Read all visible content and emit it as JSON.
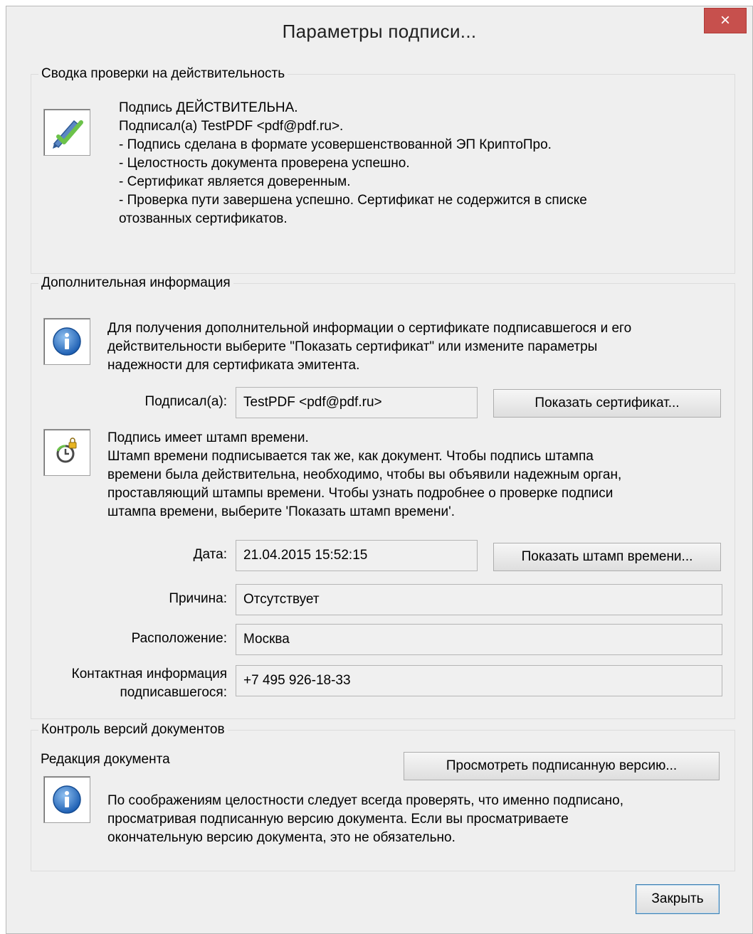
{
  "window": {
    "title": "Параметры подписи...",
    "close_glyph": "×"
  },
  "summary": {
    "legend": "Сводка проверки на действительность",
    "icon": "pen-checkmark-icon",
    "lines": [
      "Подпись ДЕЙСТВИТЕЛЬНА.",
      "Подписал(а) TestPDF <pdf@pdf.ru>.",
      "- Подпись сделана в формате усовершенствованной ЭП КриптоПро.",
      "- Целостность документа проверена успешно.",
      "- Сертификат является доверенным.",
      "- Проверка пути завершена успешно. Сертификат не содержится в списке",
      "отозванных сертификатов."
    ]
  },
  "additional": {
    "legend": "Дополнительная информация",
    "info_icon": "info-icon",
    "info_lines": [
      "Для получения дополнительной информации о сертификате подписавшегося и его",
      "действительности выберите \"Показать сертификат\" или измените параметры",
      "надежности для сертификата эмитента."
    ],
    "signer_label": "Подписал(а):",
    "signer_value": "TestPDF <pdf@pdf.ru>",
    "show_certificate_button": "Показать сертификат...",
    "timestamp_icon": "clock-key-icon",
    "timestamp_lines": [
      "Подпись имеет штамп времени.",
      "Штамп времени подписывается так же, как документ. Чтобы подпись штампа",
      "времени была действительна, необходимо, чтобы вы объявили надежным орган,",
      "проставляющий штампы времени. Чтобы узнать подробнее о проверке подписи",
      "штампа времени, выберите 'Показать штамп времени'."
    ],
    "date_label": "Дата:",
    "date_value": "21.04.2015 15:52:15",
    "show_timestamp_button": "Показать штамп времени...",
    "reason_label": "Причина:",
    "reason_value": "Отсутствует",
    "location_label": "Расположение:",
    "location_value": "Москва",
    "contact_label_line1": "Контактная информация",
    "contact_label_line2": "подписавшегося:",
    "contact_value": "+7 495 926-18-33"
  },
  "versions": {
    "legend": "Контроль версий документов",
    "revision_label": "Редакция документа",
    "view_signed_button": "Просмотреть подписанную версию...",
    "info_icon": "info-icon",
    "info_lines": [
      "По соображениям целостности следует всегда проверять, что именно подписано,",
      "просматривая подписанную версию документа. Если вы просматриваете",
      "окончательную версию документа, это не обязательно."
    ]
  },
  "footer": {
    "close_button": "Закрыть"
  }
}
